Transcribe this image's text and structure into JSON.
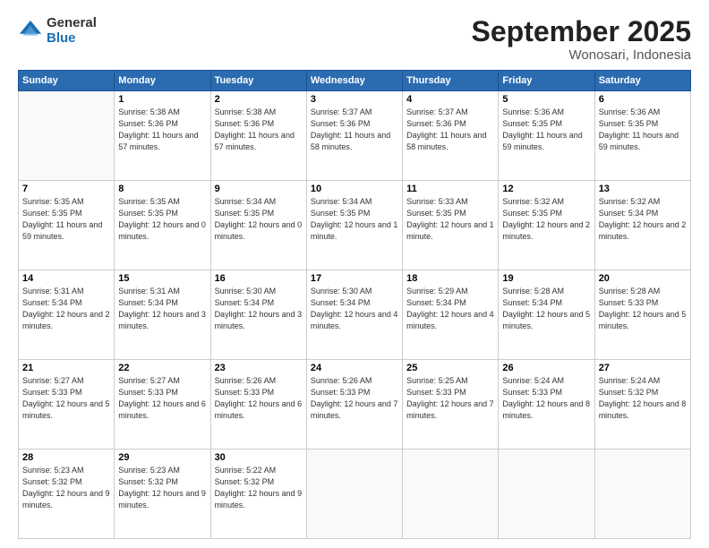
{
  "logo": {
    "general": "General",
    "blue": "Blue"
  },
  "title": "September 2025",
  "location": "Wonosari, Indonesia",
  "weekdays": [
    "Sunday",
    "Monday",
    "Tuesday",
    "Wednesday",
    "Thursday",
    "Friday",
    "Saturday"
  ],
  "weeks": [
    [
      {
        "day": "",
        "sunrise": "",
        "sunset": "",
        "daylight": ""
      },
      {
        "day": "1",
        "sunrise": "Sunrise: 5:38 AM",
        "sunset": "Sunset: 5:36 PM",
        "daylight": "Daylight: 11 hours and 57 minutes."
      },
      {
        "day": "2",
        "sunrise": "Sunrise: 5:38 AM",
        "sunset": "Sunset: 5:36 PM",
        "daylight": "Daylight: 11 hours and 57 minutes."
      },
      {
        "day": "3",
        "sunrise": "Sunrise: 5:37 AM",
        "sunset": "Sunset: 5:36 PM",
        "daylight": "Daylight: 11 hours and 58 minutes."
      },
      {
        "day": "4",
        "sunrise": "Sunrise: 5:37 AM",
        "sunset": "Sunset: 5:36 PM",
        "daylight": "Daylight: 11 hours and 58 minutes."
      },
      {
        "day": "5",
        "sunrise": "Sunrise: 5:36 AM",
        "sunset": "Sunset: 5:35 PM",
        "daylight": "Daylight: 11 hours and 59 minutes."
      },
      {
        "day": "6",
        "sunrise": "Sunrise: 5:36 AM",
        "sunset": "Sunset: 5:35 PM",
        "daylight": "Daylight: 11 hours and 59 minutes."
      }
    ],
    [
      {
        "day": "7",
        "sunrise": "Sunrise: 5:35 AM",
        "sunset": "Sunset: 5:35 PM",
        "daylight": "Daylight: 11 hours and 59 minutes."
      },
      {
        "day": "8",
        "sunrise": "Sunrise: 5:35 AM",
        "sunset": "Sunset: 5:35 PM",
        "daylight": "Daylight: 12 hours and 0 minutes."
      },
      {
        "day": "9",
        "sunrise": "Sunrise: 5:34 AM",
        "sunset": "Sunset: 5:35 PM",
        "daylight": "Daylight: 12 hours and 0 minutes."
      },
      {
        "day": "10",
        "sunrise": "Sunrise: 5:34 AM",
        "sunset": "Sunset: 5:35 PM",
        "daylight": "Daylight: 12 hours and 1 minute."
      },
      {
        "day": "11",
        "sunrise": "Sunrise: 5:33 AM",
        "sunset": "Sunset: 5:35 PM",
        "daylight": "Daylight: 12 hours and 1 minute."
      },
      {
        "day": "12",
        "sunrise": "Sunrise: 5:32 AM",
        "sunset": "Sunset: 5:35 PM",
        "daylight": "Daylight: 12 hours and 2 minutes."
      },
      {
        "day": "13",
        "sunrise": "Sunrise: 5:32 AM",
        "sunset": "Sunset: 5:34 PM",
        "daylight": "Daylight: 12 hours and 2 minutes."
      }
    ],
    [
      {
        "day": "14",
        "sunrise": "Sunrise: 5:31 AM",
        "sunset": "Sunset: 5:34 PM",
        "daylight": "Daylight: 12 hours and 2 minutes."
      },
      {
        "day": "15",
        "sunrise": "Sunrise: 5:31 AM",
        "sunset": "Sunset: 5:34 PM",
        "daylight": "Daylight: 12 hours and 3 minutes."
      },
      {
        "day": "16",
        "sunrise": "Sunrise: 5:30 AM",
        "sunset": "Sunset: 5:34 PM",
        "daylight": "Daylight: 12 hours and 3 minutes."
      },
      {
        "day": "17",
        "sunrise": "Sunrise: 5:30 AM",
        "sunset": "Sunset: 5:34 PM",
        "daylight": "Daylight: 12 hours and 4 minutes."
      },
      {
        "day": "18",
        "sunrise": "Sunrise: 5:29 AM",
        "sunset": "Sunset: 5:34 PM",
        "daylight": "Daylight: 12 hours and 4 minutes."
      },
      {
        "day": "19",
        "sunrise": "Sunrise: 5:28 AM",
        "sunset": "Sunset: 5:34 PM",
        "daylight": "Daylight: 12 hours and 5 minutes."
      },
      {
        "day": "20",
        "sunrise": "Sunrise: 5:28 AM",
        "sunset": "Sunset: 5:33 PM",
        "daylight": "Daylight: 12 hours and 5 minutes."
      }
    ],
    [
      {
        "day": "21",
        "sunrise": "Sunrise: 5:27 AM",
        "sunset": "Sunset: 5:33 PM",
        "daylight": "Daylight: 12 hours and 5 minutes."
      },
      {
        "day": "22",
        "sunrise": "Sunrise: 5:27 AM",
        "sunset": "Sunset: 5:33 PM",
        "daylight": "Daylight: 12 hours and 6 minutes."
      },
      {
        "day": "23",
        "sunrise": "Sunrise: 5:26 AM",
        "sunset": "Sunset: 5:33 PM",
        "daylight": "Daylight: 12 hours and 6 minutes."
      },
      {
        "day": "24",
        "sunrise": "Sunrise: 5:26 AM",
        "sunset": "Sunset: 5:33 PM",
        "daylight": "Daylight: 12 hours and 7 minutes."
      },
      {
        "day": "25",
        "sunrise": "Sunrise: 5:25 AM",
        "sunset": "Sunset: 5:33 PM",
        "daylight": "Daylight: 12 hours and 7 minutes."
      },
      {
        "day": "26",
        "sunrise": "Sunrise: 5:24 AM",
        "sunset": "Sunset: 5:33 PM",
        "daylight": "Daylight: 12 hours and 8 minutes."
      },
      {
        "day": "27",
        "sunrise": "Sunrise: 5:24 AM",
        "sunset": "Sunset: 5:32 PM",
        "daylight": "Daylight: 12 hours and 8 minutes."
      }
    ],
    [
      {
        "day": "28",
        "sunrise": "Sunrise: 5:23 AM",
        "sunset": "Sunset: 5:32 PM",
        "daylight": "Daylight: 12 hours and 9 minutes."
      },
      {
        "day": "29",
        "sunrise": "Sunrise: 5:23 AM",
        "sunset": "Sunset: 5:32 PM",
        "daylight": "Daylight: 12 hours and 9 minutes."
      },
      {
        "day": "30",
        "sunrise": "Sunrise: 5:22 AM",
        "sunset": "Sunset: 5:32 PM",
        "daylight": "Daylight: 12 hours and 9 minutes."
      },
      {
        "day": "",
        "sunrise": "",
        "sunset": "",
        "daylight": ""
      },
      {
        "day": "",
        "sunrise": "",
        "sunset": "",
        "daylight": ""
      },
      {
        "day": "",
        "sunrise": "",
        "sunset": "",
        "daylight": ""
      },
      {
        "day": "",
        "sunrise": "",
        "sunset": "",
        "daylight": ""
      }
    ]
  ]
}
